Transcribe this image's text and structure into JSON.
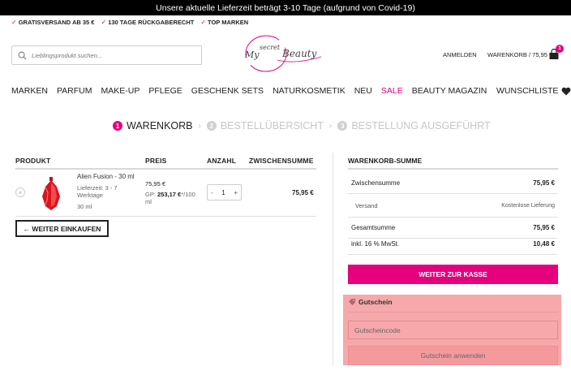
{
  "announcement": "Unsere aktuelle Lieferzeit beträgt 3-10 Tage (aufgrund von Covid-19)",
  "usps": [
    "GRATISVERSAND AB 35 €",
    "130 TAGE RÜCKGABERECHT",
    "TOP MARKEN"
  ],
  "search": {
    "placeholder": "Lieblingsprodukt suchen..."
  },
  "header": {
    "login": "ANMELDEN",
    "cart": "WARENKORB / 75,95 €",
    "cart_count": "1"
  },
  "nav": {
    "items": [
      "MARKEN",
      "PARFUM",
      "MAKE-UP",
      "PFLEGE",
      "GESCHENK SETS",
      "NATURKOSMETIK",
      "NEU",
      "SALE",
      "BEAUTY MAGAZIN"
    ],
    "wishlist": "WUNSCHLISTE"
  },
  "steps": [
    {
      "num": "1",
      "label": "WARENKORB"
    },
    {
      "num": "2",
      "label": "BESTELLÜBERSICHT"
    },
    {
      "num": "3",
      "label": "BESTELLUNG AUSGEFÜHRT"
    }
  ],
  "cart_table": {
    "headers": {
      "product": "PRODUKT",
      "price": "PREIS",
      "qty": "ANZAHL",
      "subtotal": "ZWISCHENSUMME"
    },
    "item": {
      "remove": "×",
      "name": "Alien Fusion - 30 ml",
      "delivery": "Lieferzeit: 3 - 7 Werktage",
      "size": "30 ml",
      "price": "75,95 €",
      "gp_label": "GP:",
      "gp_value": "253,17 €",
      "gp_unit": "*/100 ml",
      "qty_minus": "-",
      "qty": "1",
      "qty_plus": "+",
      "subtotal": "75,95 €"
    },
    "continue": "← WEITER EINKAUFEN"
  },
  "summary": {
    "title": "WARENKORB-SUMME",
    "rows": [
      {
        "label": "Zwischensumme",
        "value": "75,95 €"
      },
      {
        "label": "Versand",
        "value": "Kostenlose Lieferung"
      },
      {
        "label": "Gesamtsumme",
        "value": "75,95 €"
      },
      {
        "label": "inkl. 16 % MwSt.",
        "value": "10,48 €"
      }
    ],
    "checkout": "WEITER ZUR KASSE"
  },
  "coupon": {
    "title": "Gutschein",
    "placeholder": "Gutscheincode",
    "apply": "Gutschein anwenden"
  },
  "logo_text": "My secret Beauty",
  "colors": {
    "accent": "#e6007e",
    "coupon_bg": "#f7a8aa"
  }
}
